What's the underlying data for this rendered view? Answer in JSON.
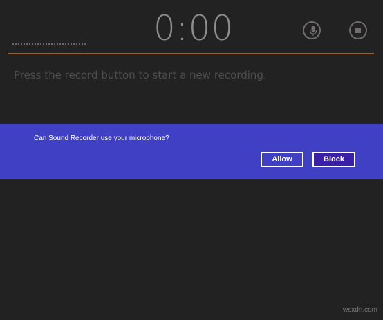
{
  "recorder": {
    "timer": "0:00",
    "hint": "Press the record button to start a new recording."
  },
  "icons": {
    "record": "microphone-icon",
    "stop": "stop-icon"
  },
  "dialog": {
    "message": "Can Sound Recorder use your microphone?",
    "allow_label": "Allow",
    "block_label": "Block"
  },
  "colors": {
    "background": "#232223",
    "accent_line": "#a0601f",
    "dialog_bg": "#4040c4",
    "block_btn_bg": "#3a20a8",
    "timer_text": "#8e8c8c"
  },
  "watermark": "wsxdn.com"
}
